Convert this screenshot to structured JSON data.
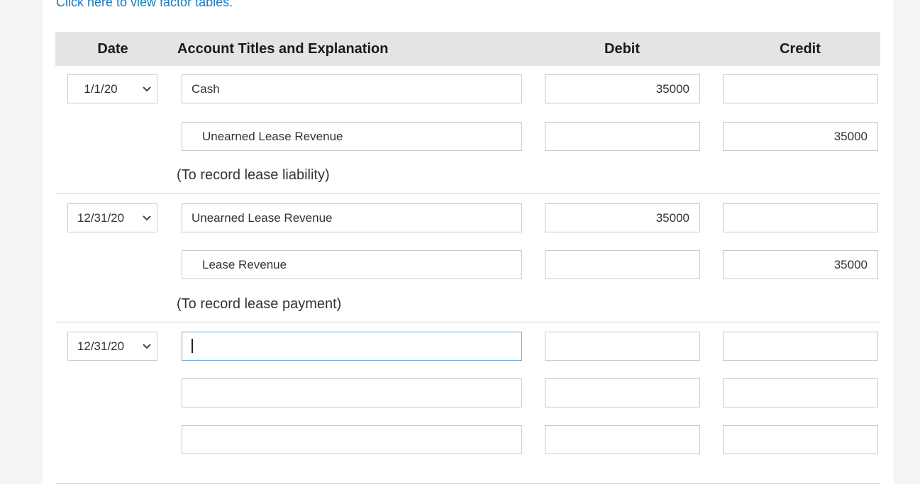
{
  "link": {
    "text": "Click here to view factor tables."
  },
  "table": {
    "headers": {
      "date": "Date",
      "account": "Account Titles and Explanation",
      "debit": "Debit",
      "credit": "Credit"
    }
  },
  "entries": [
    {
      "date": "1/1/20",
      "rows": [
        {
          "account": "Cash",
          "debit": "35000",
          "credit": ""
        },
        {
          "account": "Unearned Lease Revenue",
          "debit": "",
          "credit": "35000"
        }
      ],
      "explanation": "(To record lease liability)"
    },
    {
      "date": "12/31/20",
      "rows": [
        {
          "account": "Unearned Lease Revenue",
          "debit": "35000",
          "credit": ""
        },
        {
          "account": "Lease Revenue",
          "debit": "",
          "credit": "35000"
        }
      ],
      "explanation": "(To record lease payment)"
    },
    {
      "date": "12/31/20",
      "rows": [
        {
          "account": "",
          "debit": "",
          "credit": ""
        },
        {
          "account": "",
          "debit": "",
          "credit": ""
        },
        {
          "account": "",
          "debit": "",
          "credit": ""
        }
      ]
    }
  ],
  "icons": {
    "dropdown": "chevron-down-icon"
  },
  "colors": {
    "link": "#1a7bbf",
    "header_bg": "#e4e4e4",
    "focus_border": "#6fa8dc"
  }
}
